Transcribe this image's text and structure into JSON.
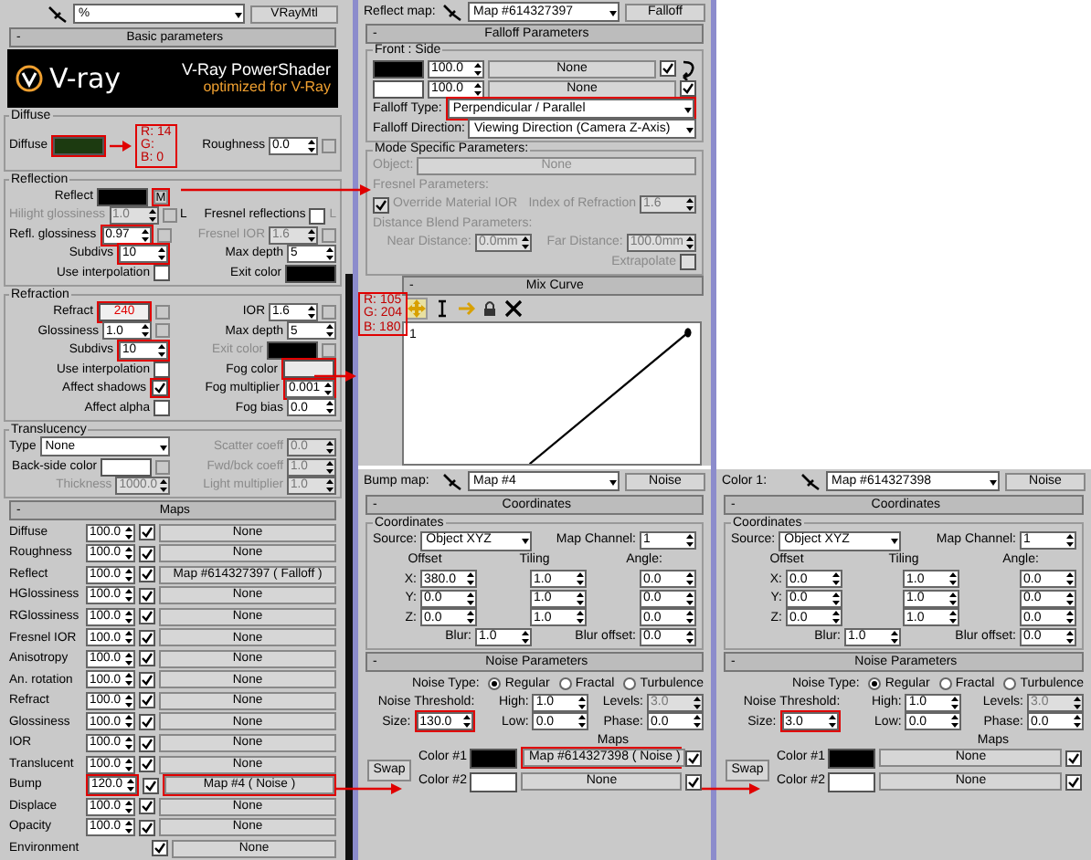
{
  "material": {
    "toolbar": {
      "slot_name": "%",
      "type_button": "VRayMtl"
    },
    "rollout": {
      "toggle": "-",
      "title": "Basic parameters"
    },
    "banner": {
      "logo": "V-ray",
      "title": "V-Ray PowerShader",
      "subtitle": "optimized for V-Ray"
    },
    "groups": [
      {
        "title": "Diffuse",
        "rows": [
          [
            [
              {
                "kind": "label",
                "text": "Diffuse"
              },
              {
                "kind": "swatch",
                "color": "#1c3a10",
                "marked": true
              },
              {
                "kind": "arrow"
              },
              {
                "kind": "note",
                "lines": [
                  "R: 14",
                  "G:",
                  "B: 0"
                ]
              }
            ],
            [
              {
                "kind": "label",
                "text": "Roughness"
              },
              {
                "kind": "spinner",
                "value": "0.0"
              },
              {
                "kind": "slot"
              }
            ]
          ]
        ]
      },
      {
        "title": "Reflection",
        "rows": [
          [
            [
              {
                "kind": "label",
                "text": "Reflect"
              },
              {
                "kind": "swatch",
                "color": "#000000"
              },
              {
                "kind": "slot",
                "text": "M",
                "marked": true
              }
            ],
            []
          ],
          [
            [
              {
                "kind": "label",
                "text": "Hilight glossiness",
                "disabled": true
              },
              {
                "kind": "spinner",
                "value": "1.0",
                "disabled": true
              },
              {
                "kind": "slot"
              },
              {
                "kind": "label",
                "text": "L"
              }
            ],
            [
              {
                "kind": "label",
                "text": "Fresnel reflections"
              },
              {
                "kind": "check",
                "checked": false
              },
              {
                "kind": "label",
                "text": "L",
                "disabled": true
              }
            ]
          ],
          [
            [
              {
                "kind": "label",
                "text": "Refl. glossiness"
              },
              {
                "kind": "spinner",
                "value": "0.97",
                "marked": true
              },
              {
                "kind": "slot"
              }
            ],
            [
              {
                "kind": "label",
                "text": "Fresnel IOR",
                "disabled": true
              },
              {
                "kind": "spinner",
                "value": "1.6",
                "disabled": true
              },
              {
                "kind": "slot"
              }
            ]
          ],
          [
            [
              {
                "kind": "label",
                "text": "Subdivs"
              },
              {
                "kind": "spinner",
                "value": "10",
                "marked": true
              }
            ],
            [
              {
                "kind": "label",
                "text": "Max depth"
              },
              {
                "kind": "spinner",
                "value": "5"
              }
            ]
          ],
          [
            [
              {
                "kind": "label",
                "text": "Use interpolation"
              },
              {
                "kind": "check",
                "checked": false
              }
            ],
            [
              {
                "kind": "label",
                "text": "Exit color"
              },
              {
                "kind": "swatch",
                "color": "#000000"
              }
            ]
          ]
        ]
      },
      {
        "title": "Refraction",
        "rows": [
          [
            [
              {
                "kind": "label",
                "text": "Refract"
              },
              {
                "kind": "swatch",
                "color": "#f0f0f0",
                "note": "240",
                "marked": true
              },
              {
                "kind": "slot"
              }
            ],
            [
              {
                "kind": "label",
                "text": "IOR"
              },
              {
                "kind": "spinner",
                "value": "1.6"
              },
              {
                "kind": "slot"
              }
            ]
          ],
          [
            [
              {
                "kind": "label",
                "text": "Glossiness"
              },
              {
                "kind": "spinner",
                "value": "1.0"
              },
              {
                "kind": "slot"
              }
            ],
            [
              {
                "kind": "label",
                "text": "Max depth"
              },
              {
                "kind": "spinner",
                "value": "5"
              }
            ]
          ],
          [
            [
              {
                "kind": "label",
                "text": "Subdivs"
              },
              {
                "kind": "spinner",
                "value": "10",
                "marked": true
              }
            ],
            [
              {
                "kind": "label",
                "text": "Exit color",
                "disabled": true
              },
              {
                "kind": "swatch",
                "color": "#000000"
              },
              {
                "kind": "slot"
              }
            ]
          ],
          [
            [
              {
                "kind": "label",
                "text": "Use interpolation"
              },
              {
                "kind": "check",
                "checked": false
              }
            ],
            [
              {
                "kind": "label",
                "text": "Fog color"
              },
              {
                "kind": "swatch",
                "color": "#eaeaea",
                "marked": true
              }
            ]
          ],
          [
            [
              {
                "kind": "label",
                "text": "Affect shadows"
              },
              {
                "kind": "check",
                "checked": true,
                "marked": true
              }
            ],
            [
              {
                "kind": "label",
                "text": "Fog multiplier"
              },
              {
                "kind": "spinner",
                "value": "0.001",
                "marked": true
              }
            ]
          ],
          [
            [
              {
                "kind": "label",
                "text": "Affect alpha"
              },
              {
                "kind": "check",
                "checked": false
              }
            ],
            [
              {
                "kind": "label",
                "text": "Fog bias"
              },
              {
                "kind": "spinner",
                "value": "0.0"
              }
            ]
          ]
        ]
      },
      {
        "title": "Translucency",
        "rows": [
          [
            [
              {
                "kind": "label",
                "text": "Type"
              },
              {
                "kind": "dropdown",
                "value": "None"
              }
            ],
            [
              {
                "kind": "label",
                "text": "Scatter coeff",
                "disabled": true
              },
              {
                "kind": "spinner",
                "value": "0.0",
                "disabled": true
              }
            ]
          ],
          [
            [
              {
                "kind": "label",
                "text": "Back-side color"
              },
              {
                "kind": "swatch",
                "color": "#ffffff"
              },
              {
                "kind": "slot"
              }
            ],
            [
              {
                "kind": "label",
                "text": "Fwd/bck coeff",
                "disabled": true
              },
              {
                "kind": "spinner",
                "value": "1.0",
                "disabled": true
              }
            ]
          ],
          [
            [
              {
                "kind": "label",
                "text": "Thickness",
                "disabled": true
              },
              {
                "kind": "spinner",
                "value": "1000.0",
                "disabled": true
              }
            ],
            [
              {
                "kind": "label",
                "text": "Light multiplier",
                "disabled": true
              },
              {
                "kind": "spinner",
                "value": "1.0",
                "disabled": true
              }
            ]
          ]
        ]
      }
    ],
    "maps_rollout": {
      "toggle": "-",
      "title": "Maps"
    },
    "maps": [
      {
        "name": "Diffuse",
        "amount": "100.0",
        "amount_marked": false,
        "enabled": true,
        "map": "None",
        "map_marked": false
      },
      {
        "name": "Roughness",
        "amount": "100.0",
        "amount_marked": false,
        "enabled": true,
        "map": "None",
        "map_marked": false
      },
      {
        "name": "Reflect",
        "amount": "100.0",
        "amount_marked": false,
        "enabled": true,
        "map": "Map #614327397 ( Falloff )",
        "map_marked": false
      },
      {
        "name": "HGlossiness",
        "amount": "100.0",
        "amount_marked": false,
        "enabled": true,
        "map": "None",
        "map_marked": false
      },
      {
        "name": "RGlossiness",
        "amount": "100.0",
        "amount_marked": false,
        "enabled": true,
        "map": "None",
        "map_marked": false
      },
      {
        "name": "Fresnel IOR",
        "amount": "100.0",
        "amount_marked": false,
        "enabled": true,
        "map": "None",
        "map_marked": false
      },
      {
        "name": "Anisotropy",
        "amount": "100.0",
        "amount_marked": false,
        "enabled": true,
        "map": "None",
        "map_marked": false
      },
      {
        "name": "An. rotation",
        "amount": "100.0",
        "amount_marked": false,
        "enabled": true,
        "map": "None",
        "map_marked": false
      },
      {
        "name": "Refract",
        "amount": "100.0",
        "amount_marked": false,
        "enabled": true,
        "map": "None",
        "map_marked": false
      },
      {
        "name": "Glossiness",
        "amount": "100.0",
        "amount_marked": false,
        "enabled": true,
        "map": "None",
        "map_marked": false
      },
      {
        "name": "IOR",
        "amount": "100.0",
        "amount_marked": false,
        "enabled": true,
        "map": "None",
        "map_marked": false
      },
      {
        "name": "Translucent",
        "amount": "100.0",
        "amount_marked": false,
        "enabled": true,
        "map": "None",
        "map_marked": false
      },
      {
        "name": "Bump",
        "amount": "120.0",
        "amount_marked": true,
        "enabled": true,
        "map": "Map #4 ( Noise )",
        "map_marked": true
      },
      {
        "name": "Displace",
        "amount": "100.0",
        "amount_marked": false,
        "enabled": true,
        "map": "None",
        "map_marked": false
      },
      {
        "name": "Opacity",
        "amount": "100.0",
        "amount_marked": false,
        "enabled": true,
        "map": "None",
        "map_marked": false
      },
      {
        "name": "Environment",
        "enabled": true,
        "map": "None",
        "map_marked": false
      }
    ]
  },
  "fog_note": {
    "lines": [
      "R: 105",
      "G: 204",
      "B: 180"
    ]
  },
  "falloff": {
    "header": {
      "label": "Reflect map:",
      "map": "Map #614327397",
      "type": "Falloff"
    },
    "rollout": {
      "toggle": "-",
      "title": "Falloff Parameters"
    },
    "front_side": {
      "title": "Front : Side",
      "rows": [
        [
          [
            {
              "kind": "swatch",
              "color": "#000000"
            },
            {
              "kind": "spinner",
              "value": "100.0"
            },
            {
              "kind": "button",
              "text": "None"
            },
            {
              "kind": "check",
              "checked": true
            },
            {
              "kind": "swap"
            }
          ]
        ],
        [
          [
            {
              "kind": "swatch",
              "color": "#ffffff"
            },
            {
              "kind": "spinner",
              "value": "100.0"
            },
            {
              "kind": "button",
              "text": "None"
            },
            {
              "kind": "check",
              "checked": true
            }
          ]
        ],
        [
          [
            {
              "kind": "label",
              "text": "Falloff Type:"
            },
            {
              "kind": "dropdown",
              "value": "Perpendicular / Parallel",
              "marked": true
            }
          ]
        ],
        [
          [
            {
              "kind": "label",
              "text": "Falloff Direction:"
            },
            {
              "kind": "dropdown",
              "value": "Viewing Direction (Camera Z-Axis)"
            }
          ]
        ]
      ]
    },
    "mode_group": {
      "title": "Mode Specific Parameters:",
      "rows": [
        [
          [
            {
              "kind": "label",
              "text": "Object:",
              "disabled": true
            },
            {
              "kind": "button",
              "text": "None",
              "disabled": true
            }
          ]
        ],
        [
          [
            {
              "kind": "heading",
              "text": "Fresnel Parameters:",
              "disabled": true
            }
          ]
        ],
        [
          [
            {
              "kind": "check",
              "checked": true,
              "disabled": true
            },
            {
              "kind": "label",
              "text": "Override Material IOR",
              "disabled": true
            }
          ],
          [
            {
              "kind": "label",
              "text": "Index of Refraction",
              "disabled": true
            },
            {
              "kind": "spinner",
              "value": "1.6",
              "disabled": true
            }
          ]
        ],
        [
          [
            {
              "kind": "heading",
              "text": "Distance Blend Parameters:",
              "disabled": true
            }
          ]
        ],
        [
          [
            {
              "kind": "label",
              "text": "Near Distance:",
              "disabled": true
            },
            {
              "kind": "spinner",
              "value": "0.0mm",
              "disabled": true
            }
          ],
          [
            {
              "kind": "label",
              "text": "Far Distance:",
              "disabled": true
            },
            {
              "kind": "spinner",
              "value": "100.0mm",
              "disabled": true
            }
          ]
        ],
        [
          [],
          [
            {
              "kind": "label",
              "text": "Extrapolate",
              "disabled": true
            },
            {
              "kind": "check",
              "checked": false,
              "disabled": true
            }
          ]
        ]
      ]
    },
    "curve_rollout": {
      "toggle": "-",
      "title": "Mix Curve"
    },
    "curve_axis_label": "1"
  },
  "bump_noise": {
    "header": {
      "label": "Bump map:",
      "map": "Map #4",
      "type": "Noise"
    },
    "coordinates": {
      "rollout": {
        "toggle": "-",
        "title": "Coordinates"
      },
      "group": "Coordinates",
      "rows": [
        [
          [
            {
              "kind": "label",
              "text": "Source:"
            },
            {
              "kind": "dropdown",
              "value": "Object XYZ"
            }
          ],
          [
            {
              "kind": "label",
              "text": "Map Channel:"
            },
            {
              "kind": "spinner",
              "value": "1"
            }
          ]
        ],
        [
          [
            {
              "kind": "caption",
              "text": "Offset"
            }
          ],
          [
            {
              "kind": "caption",
              "text": "Tiling"
            }
          ],
          [
            {
              "kind": "caption",
              "text": "Angle:"
            }
          ]
        ],
        [
          [
            {
              "kind": "label",
              "text": "X:"
            },
            {
              "kind": "spinner",
              "value": "380.0"
            }
          ],
          [
            {
              "kind": "spinner",
              "value": "1.0"
            }
          ],
          [
            {
              "kind": "spinner",
              "value": "0.0"
            }
          ]
        ],
        [
          [
            {
              "kind": "label",
              "text": "Y:"
            },
            {
              "kind": "spinner",
              "value": "0.0"
            }
          ],
          [
            {
              "kind": "spinner",
              "value": "1.0"
            }
          ],
          [
            {
              "kind": "spinner",
              "value": "0.0"
            }
          ]
        ],
        [
          [
            {
              "kind": "label",
              "text": "Z:"
            },
            {
              "kind": "spinner",
              "value": "0.0"
            }
          ],
          [
            {
              "kind": "spinner",
              "value": "1.0"
            }
          ],
          [
            {
              "kind": "spinner",
              "value": "0.0"
            }
          ]
        ],
        [
          [
            {
              "kind": "label",
              "text": "Blur:"
            },
            {
              "kind": "spinner",
              "value": "1.0"
            }
          ],
          [
            {
              "kind": "label",
              "text": "Blur offset:"
            },
            {
              "kind": "spinner",
              "value": "0.0"
            }
          ]
        ]
      ]
    },
    "noise": {
      "rollout": {
        "toggle": "-",
        "title": "Noise Parameters"
      },
      "rows": [
        [
          [
            {
              "kind": "label",
              "text": "Noise Type:"
            },
            {
              "kind": "radio",
              "text": "Regular",
              "selected": true
            },
            {
              "kind": "radio",
              "text": "Fractal",
              "selected": false
            },
            {
              "kind": "radio",
              "text": "Turbulence",
              "selected": false
            }
          ]
        ],
        [
          [
            {
              "kind": "label",
              "text": "Noise Threshold:"
            }
          ],
          [
            {
              "kind": "label",
              "text": "High:"
            },
            {
              "kind": "spinner",
              "value": "1.0"
            }
          ],
          [
            {
              "kind": "label",
              "text": "Levels:"
            },
            {
              "kind": "spinner",
              "value": "3.0",
              "disabled": true
            }
          ]
        ],
        [
          [
            {
              "kind": "label",
              "text": "Size:"
            },
            {
              "kind": "spinner",
              "value": "130.0",
              "marked": true
            }
          ],
          [
            {
              "kind": "label",
              "text": "Low:"
            },
            {
              "kind": "spinner",
              "value": "0.0"
            }
          ],
          [
            {
              "kind": "label",
              "text": "Phase:"
            },
            {
              "kind": "spinner",
              "value": "0.0"
            }
          ]
        ]
      ],
      "maps_label": "Maps",
      "swap": "Swap",
      "colors": [
        {
          "label": "Color #1",
          "color": "#000000",
          "map": "Map #614327398 ( Noise )",
          "map_marked": true,
          "enabled": true
        },
        {
          "label": "Color #2",
          "color": "#ffffff",
          "map": "None",
          "map_marked": false,
          "enabled": true
        }
      ]
    }
  },
  "color_noise": {
    "header": {
      "label": "Color 1:",
      "map": "Map #614327398",
      "type": "Noise"
    },
    "coordinates": {
      "rollout": {
        "toggle": "-",
        "title": "Coordinates"
      },
      "group": "Coordinates",
      "rows": [
        [
          [
            {
              "kind": "label",
              "text": "Source:"
            },
            {
              "kind": "dropdown",
              "value": "Object XYZ"
            }
          ],
          [
            {
              "kind": "label",
              "text": "Map Channel:"
            },
            {
              "kind": "spinner",
              "value": "1"
            }
          ]
        ],
        [
          [
            {
              "kind": "caption",
              "text": "Offset"
            }
          ],
          [
            {
              "kind": "caption",
              "text": "Tiling"
            }
          ],
          [
            {
              "kind": "caption",
              "text": "Angle:"
            }
          ]
        ],
        [
          [
            {
              "kind": "label",
              "text": "X:"
            },
            {
              "kind": "spinner",
              "value": "0.0"
            }
          ],
          [
            {
              "kind": "spinner",
              "value": "1.0"
            }
          ],
          [
            {
              "kind": "spinner",
              "value": "0.0"
            }
          ]
        ],
        [
          [
            {
              "kind": "label",
              "text": "Y:"
            },
            {
              "kind": "spinner",
              "value": "0.0"
            }
          ],
          [
            {
              "kind": "spinner",
              "value": "1.0"
            }
          ],
          [
            {
              "kind": "spinner",
              "value": "0.0"
            }
          ]
        ],
        [
          [
            {
              "kind": "label",
              "text": "Z:"
            },
            {
              "kind": "spinner",
              "value": "0.0"
            }
          ],
          [
            {
              "kind": "spinner",
              "value": "1.0"
            }
          ],
          [
            {
              "kind": "spinner",
              "value": "0.0"
            }
          ]
        ],
        [
          [
            {
              "kind": "label",
              "text": "Blur:"
            },
            {
              "kind": "spinner",
              "value": "1.0"
            }
          ],
          [
            {
              "kind": "label",
              "text": "Blur offset:"
            },
            {
              "kind": "spinner",
              "value": "0.0"
            }
          ]
        ]
      ]
    },
    "noise": {
      "rollout": {
        "toggle": "-",
        "title": "Noise Parameters"
      },
      "rows": [
        [
          [
            {
              "kind": "label",
              "text": "Noise Type:"
            },
            {
              "kind": "radio",
              "text": "Regular",
              "selected": true
            },
            {
              "kind": "radio",
              "text": "Fractal",
              "selected": false
            },
            {
              "kind": "radio",
              "text": "Turbulence",
              "selected": false
            }
          ]
        ],
        [
          [
            {
              "kind": "label",
              "text": "Noise Threshold:"
            }
          ],
          [
            {
              "kind": "label",
              "text": "High:"
            },
            {
              "kind": "spinner",
              "value": "1.0"
            }
          ],
          [
            {
              "kind": "label",
              "text": "Levels:"
            },
            {
              "kind": "spinner",
              "value": "3.0",
              "disabled": true
            }
          ]
        ],
        [
          [
            {
              "kind": "label",
              "text": "Size:"
            },
            {
              "kind": "spinner",
              "value": "3.0",
              "marked": true
            }
          ],
          [
            {
              "kind": "label",
              "text": "Low:"
            },
            {
              "kind": "spinner",
              "value": "0.0"
            }
          ],
          [
            {
              "kind": "label",
              "text": "Phase:"
            },
            {
              "kind": "spinner",
              "value": "0.0"
            }
          ]
        ]
      ],
      "maps_label": "Maps",
      "swap": "Swap",
      "colors": [
        {
          "label": "Color #1",
          "color": "#000000",
          "map": "None",
          "map_marked": false,
          "enabled": true
        },
        {
          "label": "Color #2",
          "color": "#ffffff",
          "map": "None",
          "map_marked": false,
          "enabled": true
        }
      ]
    }
  }
}
